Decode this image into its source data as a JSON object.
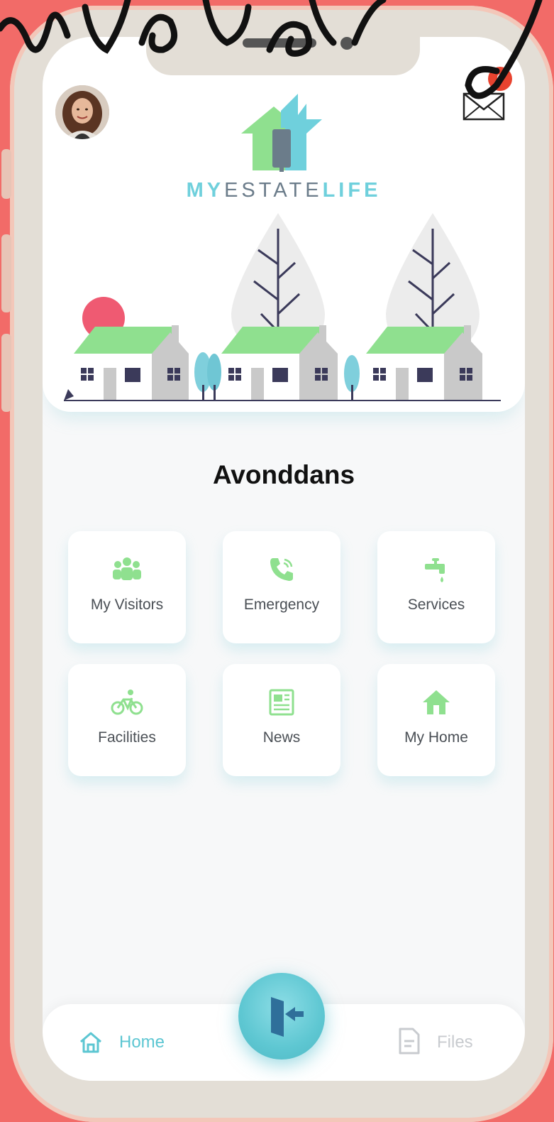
{
  "header": {
    "brand": {
      "part1": "MY",
      "part2": "ESTATE",
      "part3": "LIFE"
    },
    "mail_badge_count": "0"
  },
  "estate": {
    "title": "Avonddans"
  },
  "tiles": [
    {
      "label": "My Visitors",
      "icon": "visitors-icon"
    },
    {
      "label": "Emergency",
      "icon": "phone-icon"
    },
    {
      "label": "Services",
      "icon": "tap-icon"
    },
    {
      "label": "Facilities",
      "icon": "bicycle-icon"
    },
    {
      "label": "News",
      "icon": "newspaper-icon"
    },
    {
      "label": "My Home",
      "icon": "house-icon"
    }
  ],
  "bottom_nav": {
    "home_label": "Home",
    "files_label": "Files",
    "fab_icon": "logout-door-icon"
  },
  "colors": {
    "accent": "#5cc6d2",
    "green": "#8fe08f",
    "background_frame": "#f26b68",
    "badge": "#e8432f"
  }
}
